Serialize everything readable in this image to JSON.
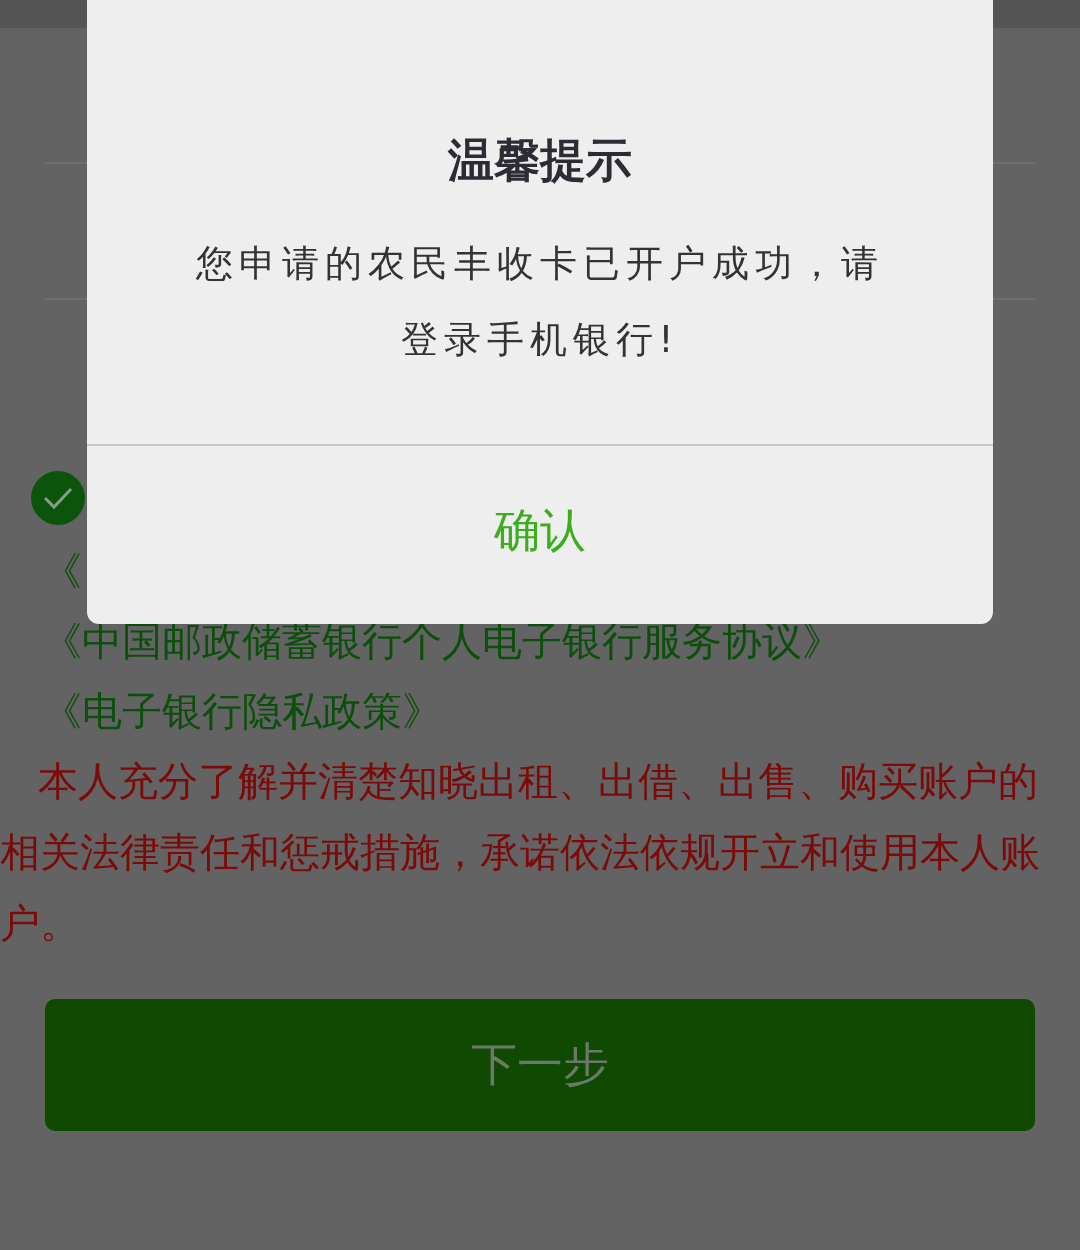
{
  "agreement": {
    "checked": true
  },
  "links": [
    "《",
    "《中国邮政储蓄银行个人电子银行服务协议》",
    "《电子银行隐私政策》"
  ],
  "notice": "本人充分了解并清楚知晓出租、出借、出售、购买账户的相关法律责任和惩戒措施，承诺依法依规开立和使用本人账户。",
  "next_button": {
    "label": "下一步",
    "disabled": true
  },
  "dialog": {
    "title": "温馨提示",
    "message": "您申请的农民丰收卡已开户成功，请登录手机银行!",
    "confirm": "确认"
  }
}
